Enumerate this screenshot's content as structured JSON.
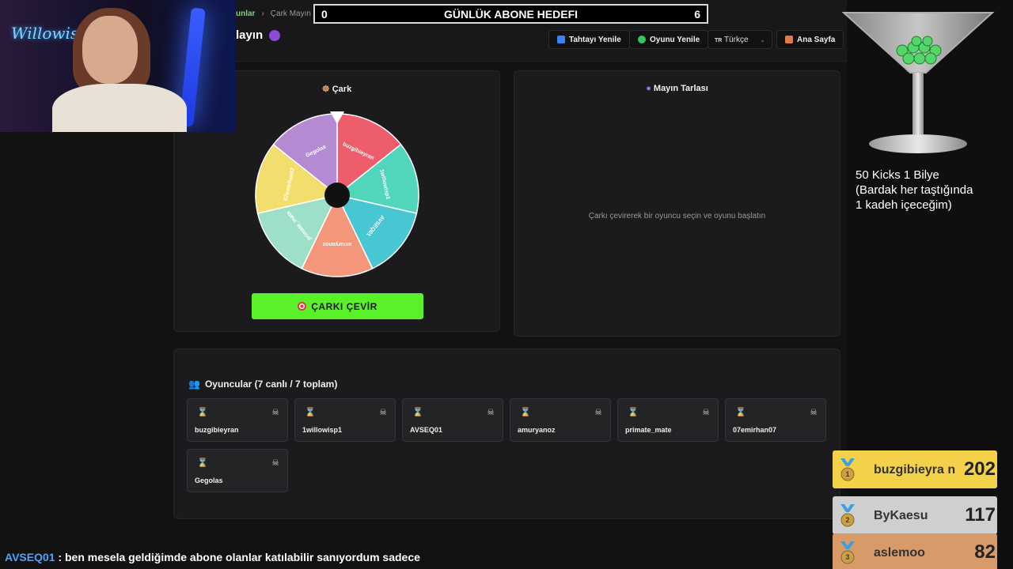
{
  "breadcrumb": {
    "parent": "unlar",
    "current": "Çark Mayın"
  },
  "page_title": "layın",
  "goal": {
    "left": "0",
    "title": "GÜNLÜK ABONE HEDEFI",
    "right": "6"
  },
  "toolbar": {
    "refresh_board": "Tahtayı Yenile",
    "refresh_game": "Oyunu Yenile",
    "lang_flag": "TR",
    "lang_value": "Türkçe",
    "home": "Ana Sayfa"
  },
  "wheel_panel": {
    "title": "Çark",
    "spin_label": "ÇARKI ÇEVİR",
    "segments": [
      {
        "name": "buzgibieyran",
        "color": "#ee5d6c"
      },
      {
        "name": "1willowisp1",
        "color": "#52d6bb"
      },
      {
        "name": "AVSEQ01",
        "color": "#48c6d2"
      },
      {
        "name": "amuryanoz",
        "color": "#f4967a"
      },
      {
        "name": "primate_mate",
        "color": "#9ee0c7"
      },
      {
        "name": "07emirhan07",
        "color": "#f2de6c"
      },
      {
        "name": "Gegolas",
        "color": "#b48ad2"
      }
    ]
  },
  "mine_panel": {
    "title": "Mayın Tarlası",
    "empty_text": "Çarkı çevirerek bir oyuncu seçin ve oyunu başlatın"
  },
  "players": {
    "title": "Oyuncular (7 canlı / 7 toplam)",
    "list": [
      "buzgibieyran",
      "1willowisp1",
      "AVSEQ01",
      "amuryanoz",
      "primate_mate",
      "07emirhan07",
      "Gegolas"
    ]
  },
  "webcam": {
    "neon_sign": "Willowisp"
  },
  "drink_overlay": {
    "line1": "50 Kicks 1 Bilye",
    "line2": "(Bardak her taştığında",
    "line3": "1 kadeh içeceğim)"
  },
  "leaderboard": [
    {
      "rank": "1",
      "name": "buzgibieyra n",
      "score": "202",
      "color": "#f3d24a"
    },
    {
      "rank": "2",
      "name": "ByKaesu",
      "score": "117",
      "color": "#cfcfcf"
    },
    {
      "rank": "3",
      "name": "aslemoo",
      "score": "82",
      "color": "#d99a6a"
    }
  ],
  "chat": {
    "user": "AVSEQ01",
    "message": " : ben mesela geldiğimde abone olanlar katılabilir sanıyordum sadece"
  }
}
